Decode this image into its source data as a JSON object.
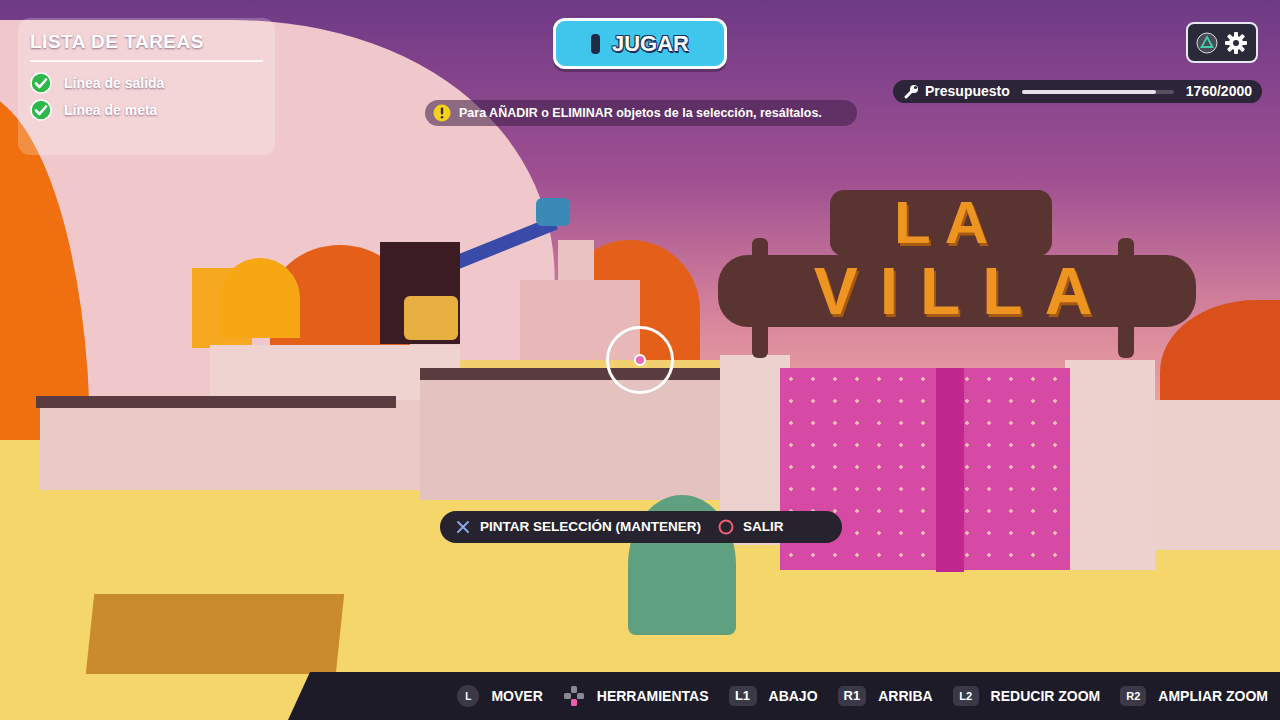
{
  "tasks": {
    "title": "LISTA DE TAREAS",
    "items": [
      {
        "label": "Línea de salida",
        "checked": true
      },
      {
        "label": "Línea de meta",
        "checked": true
      }
    ]
  },
  "play_button": {
    "label": "JUGAR"
  },
  "budget": {
    "label": "Presupuesto",
    "reading": "1760/2000",
    "level": 0.88
  },
  "hint": "Para AÑADIR o ELIMINAR objetos de la selección, resáltalos.",
  "prompt": [
    {
      "label": "PINTAR SELECCIÓN (MANTENER)",
      "kind": "cross"
    },
    {
      "label": "SALIR",
      "kind": "circle"
    }
  ],
  "controls": [
    {
      "key": "L",
      "label": "MOVER",
      "kind": "stick"
    },
    {
      "label": "HERRAMIENTAS",
      "kind": "dpad"
    },
    {
      "key": "L1",
      "label": "ABAJO",
      "kind": "key"
    },
    {
      "key": "R1",
      "label": "ARRIBA",
      "kind": "key"
    },
    {
      "key": "L2",
      "label": "REDUCIR ZOOM",
      "kind": "key"
    },
    {
      "key": "R2",
      "label": "AMPLIAR ZOOM",
      "kind": "key"
    }
  ],
  "scene": {
    "sign": [
      "LA",
      "VILLA"
    ]
  }
}
